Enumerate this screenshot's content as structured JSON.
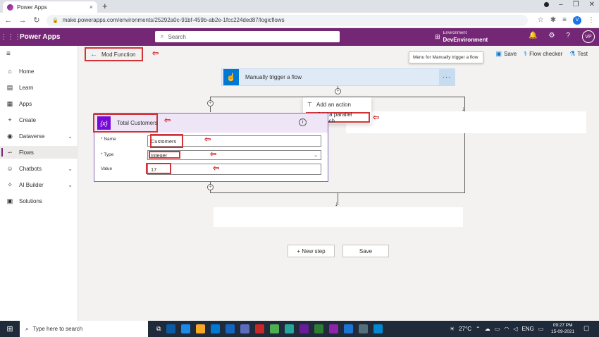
{
  "browser": {
    "tab_title": "Power Apps",
    "tab_close": "×",
    "new_tab": "+",
    "url": "make.powerapps.com/environments/25292a0c-91bf-459b-ab2e-1fcc224ded87/logicflows"
  },
  "header": {
    "app_name": "Power Apps",
    "search_placeholder": "Search",
    "environment_label": "Environment",
    "environment_name": "DevEnvironment",
    "user_initials": "VP"
  },
  "leftnav": {
    "items": [
      {
        "label": "Home",
        "icon": "home-icon"
      },
      {
        "label": "Learn",
        "icon": "book-icon"
      },
      {
        "label": "Apps",
        "icon": "apps-icon"
      },
      {
        "label": "Create",
        "icon": "plus-icon"
      },
      {
        "label": "Dataverse",
        "icon": "database-icon",
        "expandable": true
      },
      {
        "label": "Flows",
        "icon": "flows-icon",
        "active": true
      },
      {
        "label": "Chatbots",
        "icon": "chatbot-icon",
        "expandable": true
      },
      {
        "label": "AI Builder",
        "icon": "ai-icon",
        "expandable": true
      },
      {
        "label": "Solutions",
        "icon": "solutions-icon"
      }
    ]
  },
  "toolbar": {
    "flow_name": "Mod Function",
    "save_label": "Save",
    "flow_checker_label": "Flow checker",
    "test_label": "Test"
  },
  "flow": {
    "tooltip": "Menu for Manually trigger a flow",
    "trigger_title": "Manually trigger a flow",
    "menu_items": [
      "Add an action",
      "Add a parallel branch"
    ],
    "variable_card": {
      "title": "Total Customers",
      "icon_text": "{x}",
      "fields": [
        {
          "label": "Name",
          "required": true,
          "value": "Customers"
        },
        {
          "label": "Type",
          "required": true,
          "value": "Integer"
        },
        {
          "label": "Value",
          "required": false,
          "value": "17"
        }
      ]
    },
    "new_step_label": "+ New step",
    "save_label": "Save"
  },
  "taskbar": {
    "search_placeholder": "Type here to search",
    "temperature": "27°C",
    "language": "ENG",
    "time": "09:27 PM",
    "date": "15-09-2021"
  },
  "colors": {
    "brand": "#742774",
    "annotation": "#d13438",
    "trigger": "#0078d4",
    "variable": "#770bd6"
  }
}
